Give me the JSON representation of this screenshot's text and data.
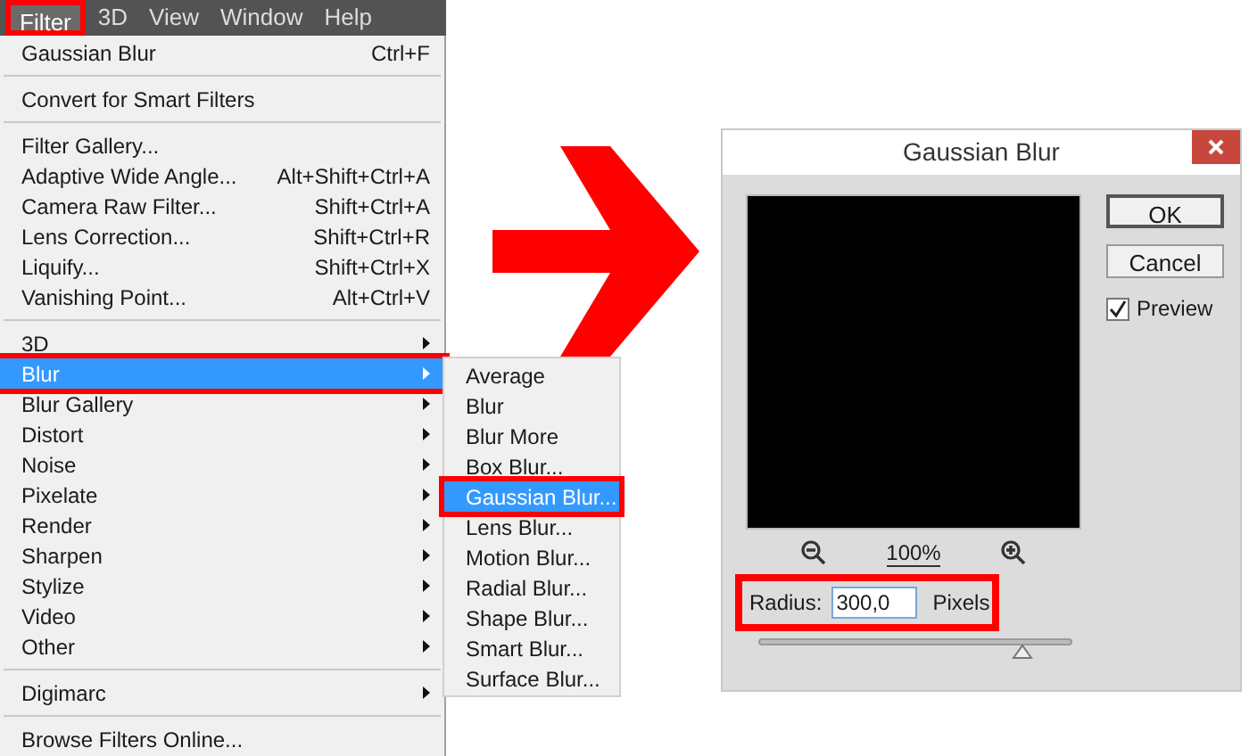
{
  "menu_bar": [
    {
      "label": "Filter",
      "selected": true,
      "annotated": true
    },
    {
      "label": "3D",
      "selected": false,
      "annotated": false
    },
    {
      "label": "View",
      "selected": false,
      "annotated": false
    },
    {
      "label": "Window",
      "selected": false,
      "annotated": false
    },
    {
      "label": "Help",
      "selected": false,
      "annotated": false
    }
  ],
  "filter_menu": [
    [
      {
        "label": "Gaussian Blur",
        "shortcut": "Ctrl+F",
        "submenu": false,
        "selected": false,
        "annotated": false
      }
    ],
    [
      {
        "label": "Convert for Smart Filters",
        "submenu": false,
        "selected": false,
        "annotated": false
      }
    ],
    [
      {
        "label": "Filter Gallery...",
        "submenu": false,
        "selected": false,
        "annotated": false
      },
      {
        "label": "Adaptive Wide Angle...",
        "shortcut": "Alt+Shift+Ctrl+A",
        "submenu": false,
        "selected": false,
        "annotated": false
      },
      {
        "label": "Camera Raw Filter...",
        "shortcut": "Shift+Ctrl+A",
        "submenu": false,
        "selected": false,
        "annotated": false
      },
      {
        "label": "Lens Correction...",
        "shortcut": "Shift+Ctrl+R",
        "submenu": false,
        "selected": false,
        "annotated": false
      },
      {
        "label": "Liquify...",
        "shortcut": "Shift+Ctrl+X",
        "submenu": false,
        "selected": false,
        "annotated": false
      },
      {
        "label": "Vanishing Point...",
        "shortcut": "Alt+Ctrl+V",
        "submenu": false,
        "selected": false,
        "annotated": false
      }
    ],
    [
      {
        "label": "3D",
        "submenu": true,
        "selected": false,
        "annotated": false
      },
      {
        "label": "Blur",
        "submenu": true,
        "selected": true,
        "annotated": true
      },
      {
        "label": "Blur Gallery",
        "submenu": true,
        "selected": false,
        "annotated": false
      },
      {
        "label": "Distort",
        "submenu": true,
        "selected": false,
        "annotated": false
      },
      {
        "label": "Noise",
        "submenu": true,
        "selected": false,
        "annotated": false
      },
      {
        "label": "Pixelate",
        "submenu": true,
        "selected": false,
        "annotated": false
      },
      {
        "label": "Render",
        "submenu": true,
        "selected": false,
        "annotated": false
      },
      {
        "label": "Sharpen",
        "submenu": true,
        "selected": false,
        "annotated": false
      },
      {
        "label": "Stylize",
        "submenu": true,
        "selected": false,
        "annotated": false
      },
      {
        "label": "Video",
        "submenu": true,
        "selected": false,
        "annotated": false
      },
      {
        "label": "Other",
        "submenu": true,
        "selected": false,
        "annotated": false
      }
    ],
    [
      {
        "label": "Digimarc",
        "submenu": true,
        "selected": false,
        "annotated": false
      }
    ],
    [
      {
        "label": "Browse Filters Online...",
        "submenu": false,
        "selected": false,
        "annotated": false
      }
    ]
  ],
  "blur_submenu": [
    {
      "label": "Average",
      "selected": false,
      "annotated": false
    },
    {
      "label": "Blur",
      "selected": false,
      "annotated": false
    },
    {
      "label": "Blur More",
      "selected": false,
      "annotated": false
    },
    {
      "label": "Box Blur...",
      "selected": false,
      "annotated": false
    },
    {
      "label": "Gaussian Blur...",
      "selected": true,
      "annotated": true
    },
    {
      "label": "Lens Blur...",
      "selected": false,
      "annotated": false
    },
    {
      "label": "Motion Blur...",
      "selected": false,
      "annotated": false
    },
    {
      "label": "Radial Blur...",
      "selected": false,
      "annotated": false
    },
    {
      "label": "Shape Blur...",
      "selected": false,
      "annotated": false
    },
    {
      "label": "Smart Blur...",
      "selected": false,
      "annotated": false
    },
    {
      "label": "Surface Blur...",
      "selected": false,
      "annotated": false
    }
  ],
  "dialog": {
    "title": "Gaussian Blur",
    "buttons": [
      "OK",
      "Cancel"
    ],
    "preview": {
      "label": "Preview",
      "checked": true
    },
    "zoom": "100%",
    "radius": {
      "label": "Radius:",
      "value": "300,0",
      "unit": "Pixels",
      "annotated": true
    },
    "slider": {
      "level": 0.84
    }
  }
}
